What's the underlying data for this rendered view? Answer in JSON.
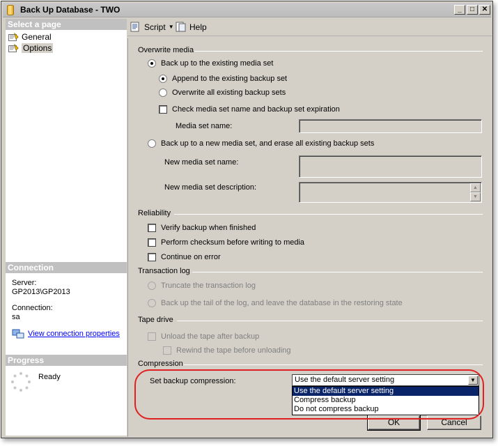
{
  "window": {
    "title": "Back Up Database - TWO"
  },
  "select_page": {
    "header": "Select a page",
    "items": [
      {
        "label": "General"
      },
      {
        "label": "Options"
      }
    ]
  },
  "connection": {
    "header": "Connection",
    "server_label": "Server:",
    "server_value": "GP2013\\GP2013",
    "connection_label": "Connection:",
    "connection_value": "sa",
    "view_link": "View connection properties"
  },
  "progress": {
    "header": "Progress",
    "status": "Ready"
  },
  "toolbar": {
    "script_label": "Script",
    "help_label": "Help"
  },
  "overwrite_media": {
    "title": "Overwrite media",
    "backup_existing": "Back up to the existing media set",
    "append": "Append to the existing backup set",
    "overwrite_all": "Overwrite all existing backup sets",
    "check_media": "Check media set name and backup set expiration",
    "media_set_name_label": "Media set name:",
    "backup_new": "Back up to a new media set, and erase all existing backup sets",
    "new_media_name_label": "New media set name:",
    "new_media_desc_label": "New media set description:"
  },
  "reliability": {
    "title": "Reliability",
    "verify": "Verify backup when finished",
    "checksum": "Perform checksum before writing to media",
    "continue_error": "Continue on error"
  },
  "transaction_log": {
    "title": "Transaction log",
    "truncate": "Truncate the transaction log",
    "tail": "Back up the tail of the log, and leave the database in the restoring state"
  },
  "tape_drive": {
    "title": "Tape drive",
    "unload": "Unload the tape after backup",
    "rewind": "Rewind the tape before unloading"
  },
  "compression": {
    "title": "Compression",
    "label": "Set backup compression:",
    "selected": "Use the default server setting",
    "options": [
      "Use the default server setting",
      "Compress backup",
      "Do not compress backup"
    ]
  },
  "buttons": {
    "ok": "OK",
    "cancel": "Cancel"
  },
  "colors": {
    "highlight_ellipse": "#e02020",
    "selection": "#0a246a",
    "link": "#0000ff"
  }
}
